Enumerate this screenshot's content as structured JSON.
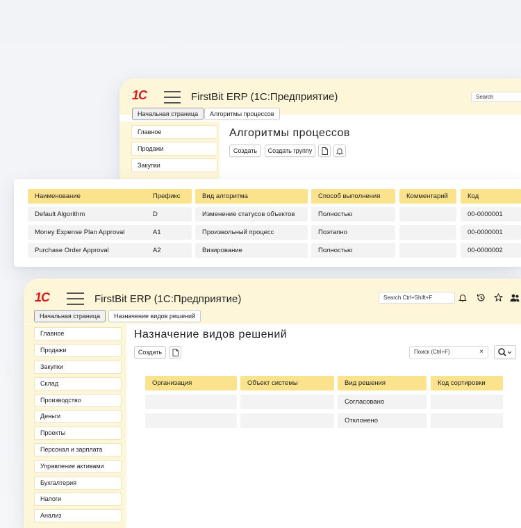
{
  "window_back": {
    "logo": "1С",
    "app_title": "FirstBit ERP (1С:Предприятие)",
    "search_placeholder": "Search",
    "tabs": [
      "Начальная страница",
      "Алгоритмы процессов"
    ],
    "sidebar": [
      "Главное",
      "Продажи",
      "Закупки"
    ],
    "page_title": "Алгоритмы процессов",
    "buttons": {
      "create": "Создать",
      "create_group": "Создать группу"
    }
  },
  "table_card": {
    "columns": [
      "Наименование",
      "Префикс",
      "Вид алгоритма",
      "Способ выполнения",
      "Комментарий",
      "Код"
    ],
    "rows": [
      [
        "Default Algorithm",
        "D",
        "Изменение статусов объектов",
        "Полностью",
        "",
        "00-0000001"
      ],
      [
        "Money Expense Plan Approval",
        "A1",
        "Произвольный процесс",
        "Поэтапно",
        "",
        "00-0000001"
      ],
      [
        "Purchase Order Approval",
        "A2",
        "Визирование",
        "Полностью",
        "",
        "00-0000002"
      ]
    ]
  },
  "window_front": {
    "logo": "1С",
    "app_title": "FirstBit ERP (1С:Предприятие)",
    "search_placeholder": "Search Ctrl+Shift+F",
    "tabs": [
      "Начальная страница",
      "Назначение видов решений"
    ],
    "sidebar": [
      "Главное",
      "Продажи",
      "Закупки",
      "Склад",
      "Производство",
      "Деньги",
      "Проекты",
      "Персонал и зарплата",
      "Управление активами",
      "Бухгалтерия",
      "Налоги",
      "Анализ"
    ],
    "page_title": "Назначение видов решений",
    "buttons": {
      "create": "Создать"
    },
    "list_search_placeholder": "Поиск (Ctrl+F)",
    "list_search_clear": "×",
    "columns": [
      "Организация",
      "Объект системы",
      "Вид решения",
      "Код сортировки"
    ],
    "rows": [
      [
        "",
        "",
        "Согласовано",
        ""
      ],
      [
        "",
        "",
        "Отклонено",
        ""
      ]
    ]
  },
  "colors": {
    "accent": "#fbe38e",
    "titlebar": "#fdf6d8",
    "logo": "#d61a1a"
  }
}
